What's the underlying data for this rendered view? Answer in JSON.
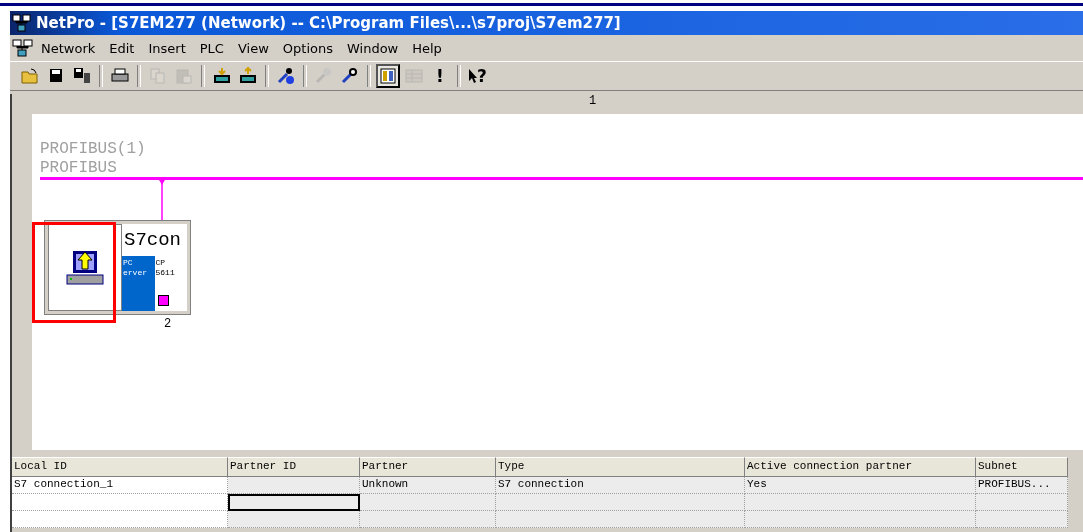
{
  "window": {
    "title": "NetPro - [S7EM277 (Network) -- C:\\Program Files\\...\\s7proj\\S7em277]"
  },
  "menu": [
    {
      "label": "Network"
    },
    {
      "label": "Edit"
    },
    {
      "label": "Insert"
    },
    {
      "label": "PLC"
    },
    {
      "label": "View"
    },
    {
      "label": "Options"
    },
    {
      "label": "Window"
    },
    {
      "label": "Help"
    }
  ],
  "toolbar": [
    {
      "kind": "open",
      "disabled": false,
      "pressed": false
    },
    {
      "kind": "save",
      "disabled": false,
      "pressed": false
    },
    {
      "kind": "compile",
      "disabled": false,
      "pressed": false
    },
    {
      "kind": "sep"
    },
    {
      "kind": "print",
      "disabled": false,
      "pressed": false
    },
    {
      "kind": "sep"
    },
    {
      "kind": "copy",
      "disabled": true,
      "pressed": false
    },
    {
      "kind": "paste",
      "disabled": true,
      "pressed": false
    },
    {
      "kind": "sep"
    },
    {
      "kind": "download",
      "disabled": false,
      "pressed": false
    },
    {
      "kind": "upload",
      "disabled": false,
      "pressed": false
    },
    {
      "kind": "sep"
    },
    {
      "kind": "info",
      "disabled": false,
      "pressed": false
    },
    {
      "kind": "sep"
    },
    {
      "kind": "plug",
      "disabled": true,
      "pressed": false
    },
    {
      "kind": "diagnose",
      "disabled": false,
      "pressed": false
    },
    {
      "kind": "sep"
    },
    {
      "kind": "catalog",
      "disabled": false,
      "pressed": true
    },
    {
      "kind": "grid",
      "disabled": true,
      "pressed": false
    },
    {
      "kind": "text",
      "label": "!",
      "disabled": false,
      "pressed": false
    },
    {
      "kind": "sep"
    },
    {
      "kind": "help",
      "label": "?",
      "disabled": false,
      "pressed": false
    }
  ],
  "ruler": {
    "label": "1"
  },
  "subnet": {
    "name": "PROFIBUS(1)",
    "type": "PROFIBUS"
  },
  "station": {
    "name": "S7con",
    "modules": [
      {
        "label": "PC\nerver",
        "color": "#0066cc"
      },
      {
        "label": "CP\n5611",
        "color": "#ffffff"
      }
    ],
    "address": "2",
    "highlighted": true
  },
  "table": {
    "columns": [
      "Local ID",
      "Partner ID",
      "Partner",
      "Type",
      "Active connection partner",
      "Subnet"
    ],
    "rows": [
      {
        "cells": [
          {
            "text": "S7 connection_1",
            "selected": false
          },
          {
            "selected": false
          },
          {
            "text": "Unknown",
            "selected": false
          },
          {
            "text": "S7 connection",
            "selected": false
          },
          {
            "text": "Yes",
            "selected": false
          },
          {
            "text": "PROFIBUS...",
            "selected": false
          }
        ]
      },
      {
        "cells": [
          {
            "selected": false
          },
          {
            "selected": true
          },
          {
            "selected": false
          },
          {
            "selected": false
          },
          {
            "selected": false
          },
          {
            "selected": false
          }
        ]
      },
      {
        "cells": [
          {
            "selected": false
          },
          {
            "selected": false
          },
          {
            "selected": false
          },
          {
            "selected": false
          },
          {
            "selected": false
          },
          {
            "selected": false
          }
        ]
      }
    ]
  }
}
